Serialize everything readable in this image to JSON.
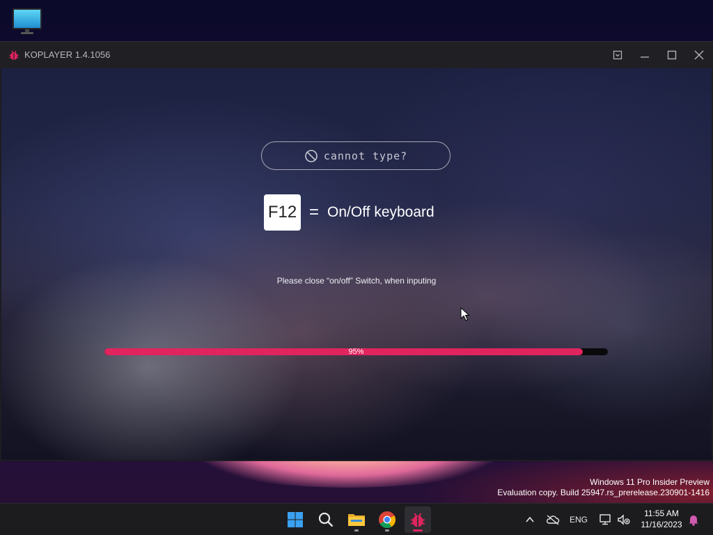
{
  "window": {
    "title": "KOPLAYER 1.4.1056"
  },
  "main": {
    "cannot_type_label": "cannot type?",
    "key_label": "F12",
    "equals": "=",
    "key_description": "On/Off keyboard",
    "hint": "Please close “on/off” Switch, when inputing",
    "progress_percent": 95,
    "progress_label": "95%"
  },
  "watermark": {
    "line1": "Windows 11 Pro Insider Preview",
    "line2": "Evaluation copy. Build 25947.rs_prerelease.230901-1416"
  },
  "taskbar": {
    "language": "ENG",
    "time": "11:55 AM",
    "date": "11/16/2023"
  },
  "colors": {
    "accent": "#e0245e",
    "titlebar": "#1f1f24",
    "taskbar": "#1c1c1f"
  },
  "icons": {
    "desktop": "this-pc-monitor-icon",
    "app": "koplayer-bug-icon",
    "start": "windows-start-icon",
    "search": "search-icon",
    "explorer": "folder-icon",
    "browser": "chrome-icon",
    "koplayer": "koplayer-icon"
  }
}
